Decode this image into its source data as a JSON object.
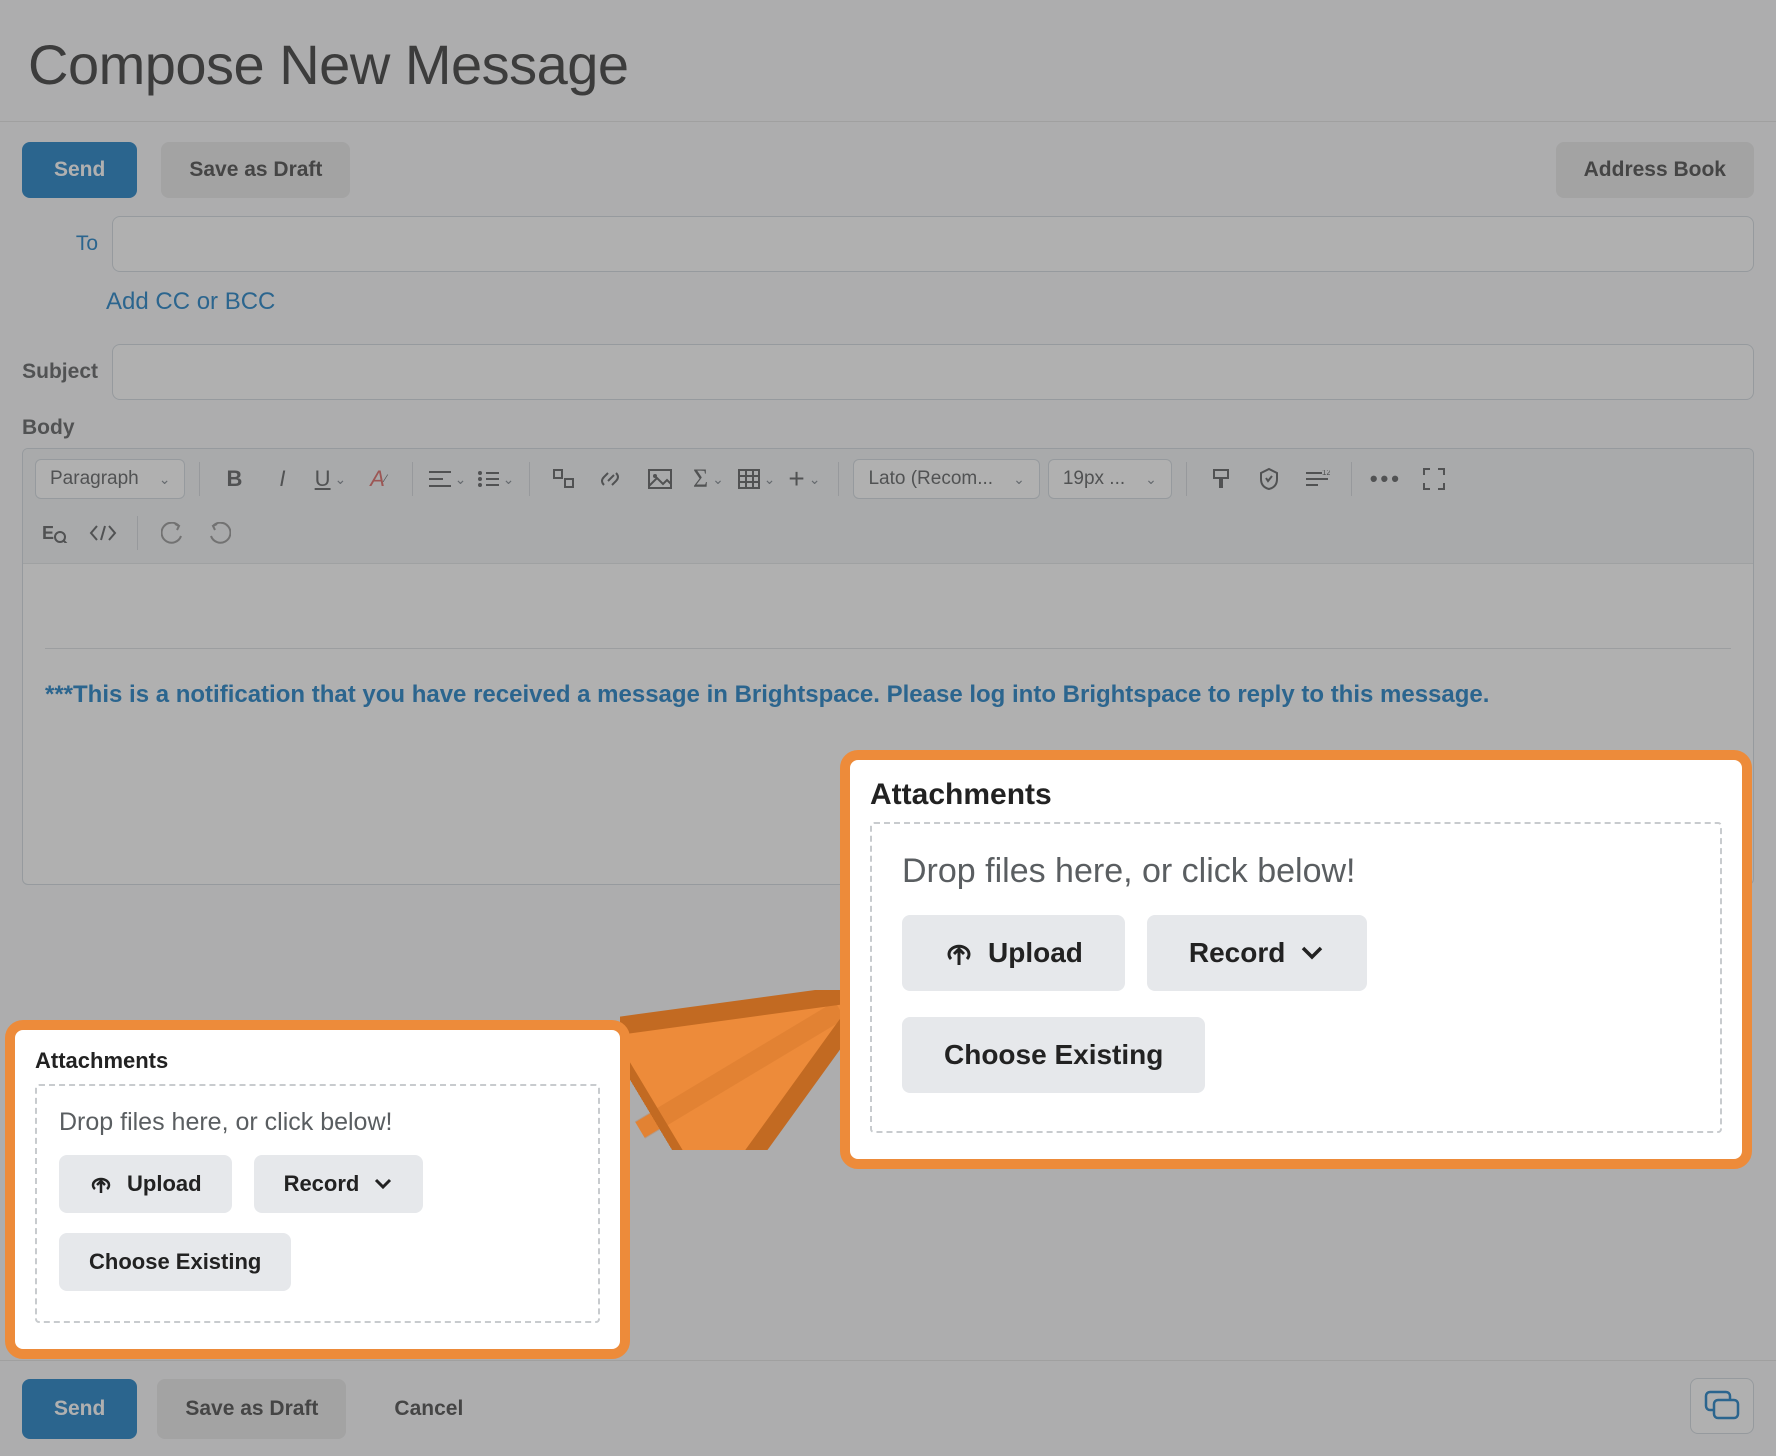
{
  "title": "Compose New Message",
  "top_buttons": {
    "send": "Send",
    "save_draft": "Save as Draft",
    "address_book": "Address Book"
  },
  "fields": {
    "to_label": "To",
    "add_cc": "Add CC or BCC",
    "subject_label": "Subject",
    "body_label": "Body"
  },
  "editor": {
    "paragraph_label": "Paragraph",
    "font_label": "Lato (Recom...",
    "size_label": "19px ...",
    "notification_text": "***This is a notification that you have received a message in Brightspace. Please log into Brightspace to reply to this message."
  },
  "attachments": {
    "title": "Attachments",
    "drop_text": "Drop files here, or click below!",
    "upload": "Upload",
    "record": "Record",
    "choose": "Choose Existing"
  },
  "bottom_buttons": {
    "send": "Send",
    "save_draft": "Save as Draft",
    "cancel": "Cancel"
  }
}
